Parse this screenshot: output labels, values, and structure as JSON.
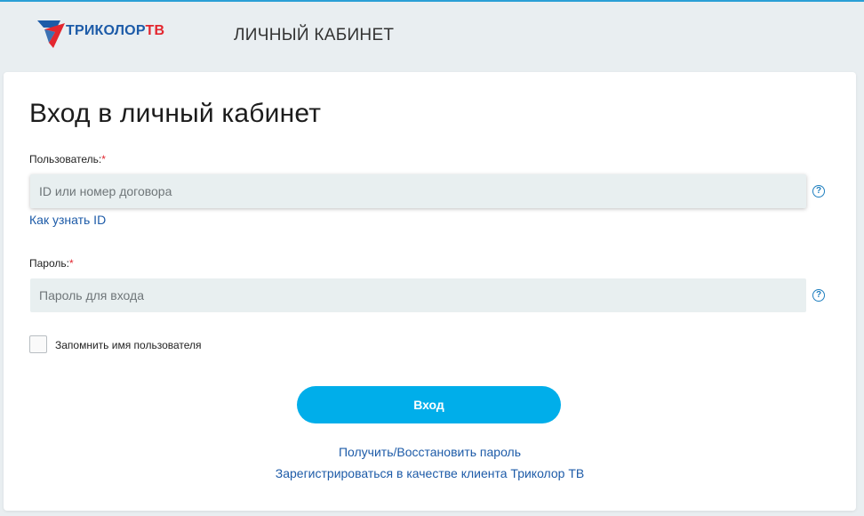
{
  "header": {
    "logo_part1": "ТРИКОЛОР",
    "logo_part2": "ТВ",
    "title": "ЛИЧНЫЙ КАБИНЕТ"
  },
  "login": {
    "title": "Вход в личный кабинет",
    "user_label": "Пользователь:",
    "required_mark": "*",
    "user_placeholder": "ID или номер договора",
    "user_value": "",
    "help_icon": "?",
    "how_to_find_id": "Как узнать ID",
    "password_label": "Пароль:",
    "password_placeholder": "Пароль для входа",
    "password_value": "",
    "remember_label": "Запомнить имя пользователя",
    "remember_checked": false,
    "submit_label": "Вход",
    "recover_link": "Получить/Восстановить пароль",
    "register_link": "Зарегистрироваться в качестве клиента Триколор ТВ"
  },
  "icons": {
    "logo": "tricolor-logo-icon",
    "help": "question-circle-icon"
  },
  "colors": {
    "brand_blue": "#1d5ba8",
    "brand_red": "#e3262f",
    "button": "#00aeea",
    "input_bg": "#e8eff0",
    "page_bg": "#e9eef1"
  }
}
